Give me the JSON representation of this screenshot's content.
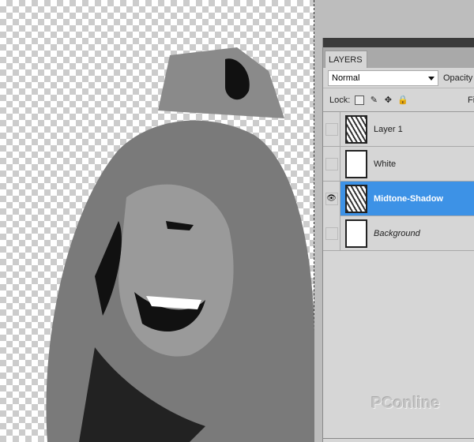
{
  "panel": {
    "tab": "LAYERS",
    "blend_mode": "Normal",
    "opacity_label": "Opacity",
    "lock_label": "Lock:",
    "fill_label": "Fill"
  },
  "layers": [
    {
      "name": "Layer 1",
      "visible": false,
      "selected": false
    },
    {
      "name": "White",
      "visible": false,
      "selected": false
    },
    {
      "name": "Midtone-Shadow",
      "visible": true,
      "selected": true
    },
    {
      "name": "Background",
      "visible": false,
      "selected": false
    }
  ],
  "colors": {
    "selection": "#3d92e6",
    "panel": "#d6d6d6"
  },
  "watermark": "PConline 太平洋电脑网"
}
